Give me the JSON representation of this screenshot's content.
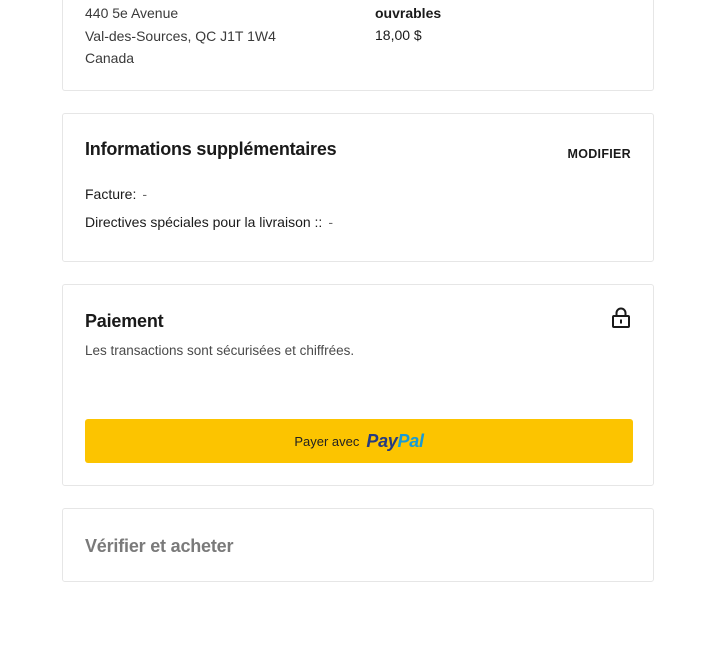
{
  "shipping": {
    "address_lines": [
      "440 5e Avenue",
      "Val-des-Sources, QC J1T 1W4",
      "Canada"
    ],
    "method_name_tail": "ouvrables",
    "method_price": "18,00 $"
  },
  "additional_info": {
    "title": "Informations supplémentaires",
    "modify_label": "MODIFIER",
    "invoice_label": "Facture:",
    "invoice_value": "-",
    "directives_label": "Directives spéciales pour la livraison ::",
    "directives_value": "-"
  },
  "payment": {
    "title": "Paiement",
    "secure_note": "Les transactions sont sécurisées et chiffrées.",
    "lock_icon": "lock-icon",
    "paypal_button": {
      "prefix": "Payer avec",
      "logo_part1": "Pay",
      "logo_part2": "Pal",
      "color": "#fcc400"
    }
  },
  "verify": {
    "title": "Vérifier et acheter"
  }
}
